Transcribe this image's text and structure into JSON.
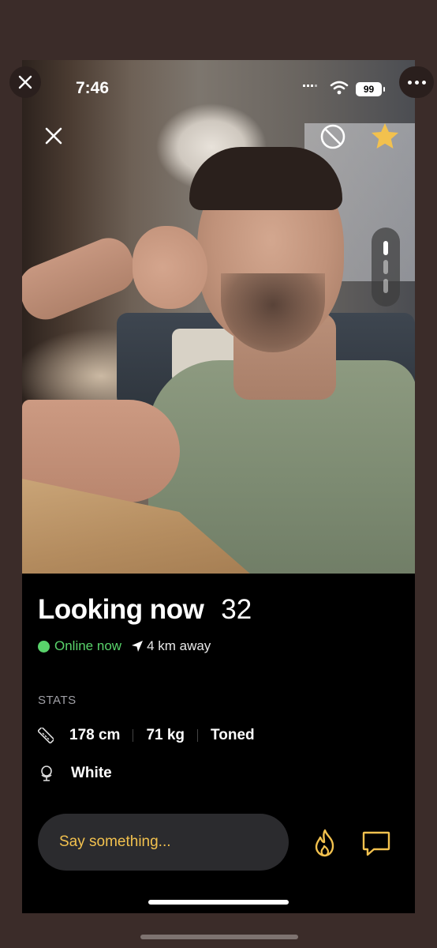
{
  "status_bar": {
    "time": "7:46",
    "battery": "99"
  },
  "profile": {
    "name": "Looking now",
    "age": "32",
    "online_status": "Online now",
    "distance": "4 km away",
    "stats_heading": "STATS",
    "height": "178 cm",
    "weight": "71 kg",
    "body_type": "Toned",
    "ethnicity": "White"
  },
  "photo_pager": {
    "total": 3,
    "active": 1
  },
  "message": {
    "placeholder": "Say something..."
  },
  "colors": {
    "accent": "#f2c14e",
    "online": "#59d36b",
    "background": "#000000",
    "input_bg": "#2b2b2e"
  },
  "icons": [
    "close-icon",
    "block-icon",
    "star-icon",
    "location-arrow-icon",
    "ruler-icon",
    "globe-icon",
    "flame-icon",
    "chat-icon",
    "more-icon"
  ]
}
